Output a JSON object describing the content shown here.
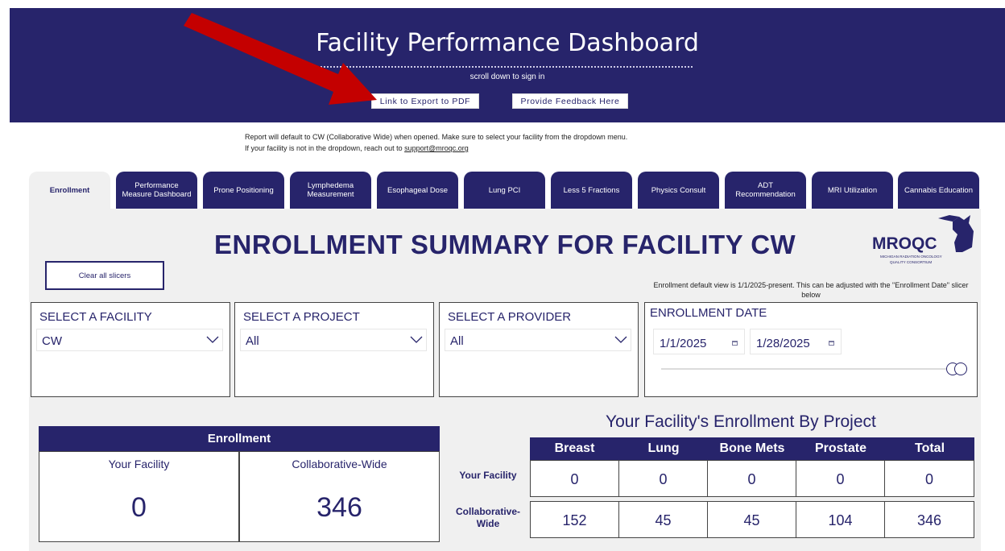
{
  "header": {
    "title": "Facility Performance Dashboard",
    "subtitle": "scroll down to sign in",
    "export_pdf_label": "Link to Export to PDF",
    "feedback_label": "Provide Feedback Here"
  },
  "notes": {
    "line1": "Report will default to CW (Collaborative Wide) when opened. Make sure to select your facility from the dropdown menu.",
    "line2_prefix": "If your facility is not in the dropdown, reach out to ",
    "support_email": "support@mroqc.org"
  },
  "tabs": [
    {
      "label": "Enrollment",
      "active": true
    },
    {
      "label": "Performance Measure Dashboard"
    },
    {
      "label": "Prone Positioning"
    },
    {
      "label": "Lymphedema Measurement"
    },
    {
      "label": "Esophageal Dose"
    },
    {
      "label": "Lung PCI"
    },
    {
      "label": "Less 5 Fractions"
    },
    {
      "label": "Physics Consult"
    },
    {
      "label": "ADT Recommendation"
    },
    {
      "label": "MRI Utilization"
    },
    {
      "label": "Cannabis Education"
    }
  ],
  "summary": {
    "title": "ENROLLMENT SUMMARY FOR FACILITY CW",
    "clear_slicers_label": "Clear all slicers",
    "enrollment_note": "Enrollment default view is 1/1/2025-present. This can be adjusted with the \"Enrollment Date\" slicer below"
  },
  "logo": {
    "wordmark": "MROQC",
    "line1": "MICHIGAN RADIATION ONCOLOGY",
    "line2": "QUALITY CONSORTIUM"
  },
  "slicers": {
    "facility": {
      "title": "SELECT A FACILITY",
      "value": "CW"
    },
    "project": {
      "title": "SELECT A PROJECT",
      "value": "All"
    },
    "provider": {
      "title": "SELECT A PROVIDER",
      "value": "All"
    },
    "date": {
      "title": "ENROLLMENT DATE",
      "start": "1/1/2025",
      "end": "1/28/2025"
    }
  },
  "enrollment_card": {
    "title": "Enrollment",
    "your_facility_label": "Your Facility",
    "your_facility_value": "0",
    "collab_label": "Collaborative-Wide",
    "collab_value": "346"
  },
  "project_table": {
    "title": "Your Facility's Enrollment By Project",
    "columns": [
      "Breast",
      "Lung",
      "Bone Mets",
      "Prostate",
      "Total"
    ],
    "rows": [
      {
        "label": "Your Facility",
        "values": [
          "0",
          "0",
          "0",
          "0",
          "0"
        ]
      },
      {
        "label": "Collaborative-Wide",
        "values": [
          "152",
          "45",
          "45",
          "104",
          "346"
        ]
      }
    ]
  },
  "colors": {
    "brand_navy": "#27246b",
    "panel_gray": "#f0f0f0",
    "arrow_red": "#c40000"
  }
}
